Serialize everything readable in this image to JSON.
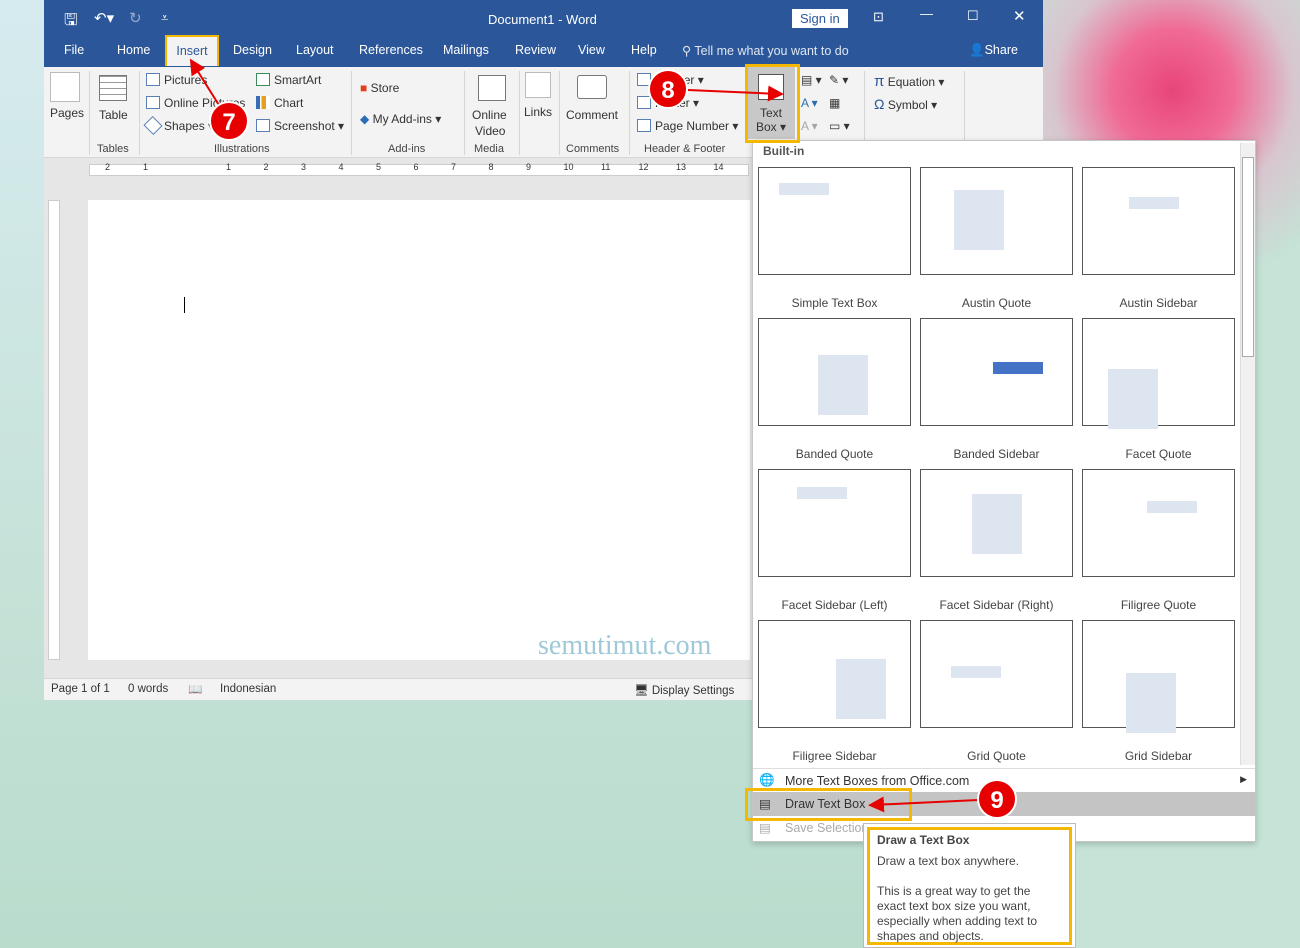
{
  "window": {
    "title": "Document1  -  Word",
    "sign_in": "Sign in",
    "share": "Share"
  },
  "tabs": [
    "File",
    "Home",
    "Insert",
    "Design",
    "Layout",
    "References",
    "Mailings",
    "Review",
    "View",
    "Help"
  ],
  "tell_me": "Tell me what you want to do",
  "ribbon": {
    "pages": "Pages",
    "table": "Table",
    "tables_group": "Tables",
    "pictures": "Pictures",
    "online_pictures": "Online Pictures",
    "shapes": "Shapes",
    "smartart": "SmartArt",
    "chart": "Chart",
    "screenshot": "Screenshot",
    "illustrations_group": "Illustrations",
    "store": "Store",
    "my_addins": "My Add-ins",
    "addins_group": "Add-ins",
    "online_video_1": "Online",
    "online_video_2": "Video",
    "media_group": "Media",
    "links": "Links",
    "comment": "Comment",
    "comments_group": "Comments",
    "header": "Header",
    "footer": "Footer",
    "page_number": "Page Number",
    "header_footer_group": "Header & Footer",
    "text_box_1": "Text",
    "text_box_2": "Box",
    "equation": "Equation",
    "symbol": "Symbol"
  },
  "ruler": [
    "2",
    "1",
    "1",
    "2",
    "3",
    "4",
    "5",
    "6",
    "7",
    "8",
    "9",
    "10",
    "11",
    "12",
    "13",
    "14"
  ],
  "status": {
    "page": "Page 1 of 1",
    "words": "0 words",
    "language": "Indonesian",
    "display": "Display Settings"
  },
  "watermark": "semutimut.com",
  "panel": {
    "section": "Built-in",
    "items": [
      "Simple Text Box",
      "Austin Quote",
      "Austin Sidebar",
      "Banded Quote",
      "Banded Sidebar",
      "Facet Quote",
      "Facet Sidebar (Left)",
      "Facet Sidebar (Right)",
      "Filigree Quote",
      "Filigree Sidebar",
      "Grid Quote",
      "Grid Sidebar"
    ],
    "more": "More Text Boxes from Office.com",
    "draw": "Draw Text Box",
    "save": "Save Selection"
  },
  "tooltip": {
    "title": "Draw a Text Box",
    "line1": "Draw a text box anywhere.",
    "line2": "This is a great way to get the exact text box size you want, especially when adding text to shapes and objects."
  },
  "steps": [
    "7",
    "8",
    "9"
  ],
  "colors": {
    "accent": "#2b579a",
    "highlight": "#f5b800",
    "step": "#e60000"
  }
}
